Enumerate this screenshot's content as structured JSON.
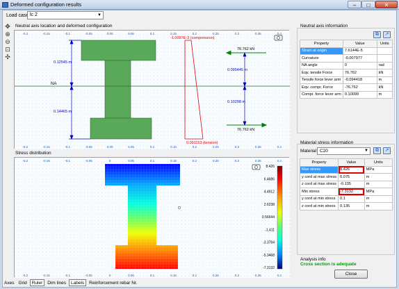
{
  "window": {
    "title": "Deformed configuration results"
  },
  "load_case": {
    "label": "Load case",
    "value": "lc 2"
  },
  "toolbar_icons": [
    "move-icon",
    "zoom-in-icon",
    "zoom-out-icon",
    "zoom-window-icon",
    "zoom-extents-icon"
  ],
  "top_panel": {
    "title": "Neutral axis location and deformed configuration",
    "labels": {
      "compression": "-1.0097E-3 (compression)",
      "tension": "0.091153 (tension)",
      "na": "NA",
      "dim_top": "0.12545 m",
      "dim_bot": "0.14465 m",
      "force_top": "76.762 kN",
      "force_bot": "76.762 kN",
      "arm_top": "0.095445 m",
      "arm_bot": "0.10298 m"
    },
    "x_ticks": [
      "-0.2",
      "-0.15",
      "-0.1",
      "-0.05",
      "0.00",
      "0.05",
      "0.1",
      "0.15",
      "0.2",
      "0.25",
      "0.3",
      "0.35",
      "0.4"
    ]
  },
  "bottom_panel": {
    "title": "Stress distribution",
    "legend": [
      "8.426",
      "6.4686",
      "4.4912",
      "2.6238",
      "0.56644",
      "-1.411",
      "-3.3784",
      "-5.3468",
      "-7.3132"
    ],
    "x_ticks": [
      "-0.2",
      "-0.15",
      "-0.1",
      "-0.05",
      "0",
      "0.05",
      "0.1",
      "0.15",
      "0.2",
      "0.25",
      "0.3",
      "0.35",
      "0.4"
    ]
  },
  "tabs": [
    "Axes",
    "Grid",
    "Ruler",
    "Dim lines",
    "Labels",
    "Reinforcement rebar Nr."
  ],
  "active_tabs": [
    "Ruler",
    "Labels"
  ],
  "neutral_axis_info": {
    "title": "Neutral axis information",
    "columns": [
      "Property",
      "Value",
      "Units"
    ],
    "rows": [
      [
        "Strain at origin",
        "7.6144E-5",
        ""
      ],
      [
        "Curvature",
        "-0.007977",
        ""
      ],
      [
        "NA angle",
        "0",
        "rad"
      ],
      [
        "Eqv. tensile Force",
        "76.762",
        "kN"
      ],
      [
        "Tensile force lever arm",
        "-0.094418",
        "m"
      ],
      [
        "Eqv. compr. Force",
        "-76.762",
        "kN"
      ],
      [
        "Compr. force lever arm",
        "0.10099",
        "m"
      ]
    ]
  },
  "material_info": {
    "title": "Material stress information",
    "material_label": "Material",
    "material_value": "C20",
    "columns": [
      "Property",
      "Value",
      "Units"
    ],
    "rows": [
      [
        "Max stress",
        "8.426",
        "MPa"
      ],
      [
        "y cord at max stress",
        "0.075",
        "m"
      ],
      [
        "z cord at max stress",
        "-0.135",
        "m"
      ],
      [
        "Min stress",
        "-7.3132",
        "MPa"
      ],
      [
        "y cord at min stress",
        "0.1",
        "m"
      ],
      [
        "z cord at min stress",
        "0.135",
        "m"
      ]
    ]
  },
  "analysis": {
    "label": "Analysis info",
    "verdict": "Cross section is adequate"
  },
  "close_label": "Close",
  "colors": {
    "section_fill": "#5aa85a",
    "tension_line": "#e00000",
    "force_arrow": "#008000",
    "dim_line": "#0000cc",
    "highlight": "#e00000"
  }
}
